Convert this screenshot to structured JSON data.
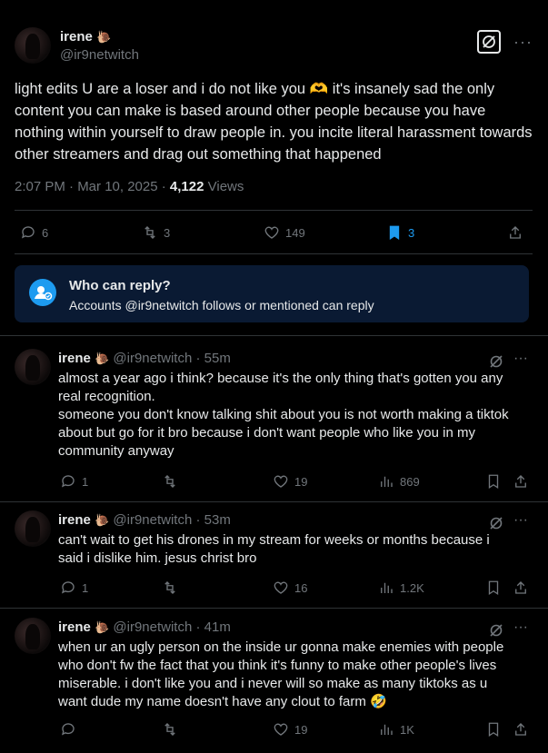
{
  "main": {
    "author_name": "irene",
    "author_badge": "🐌",
    "author_handle": "@ir9netwitch",
    "text": "light edits U are a loser and i do not like you 🫶 it's insanely sad the only content you can make is based around other people because you have nothing within yourself to draw people in. you incite literal harassment towards other streamers and drag out something that happened",
    "timestamp": "2:07 PM · Mar 10, 2025 · ",
    "views_count": "4,122",
    "views_label": " Views",
    "replies": "6",
    "reposts": "3",
    "likes": "149",
    "bookmarks": "3"
  },
  "reply_box": {
    "title": "Who can reply?",
    "subtitle": "Accounts @ir9netwitch follows or mentioned can reply"
  },
  "replies": [
    {
      "name": "irene",
      "badge": "🐌",
      "meta": "@ir9netwitch · 55m",
      "text": "almost a year ago i think? because it's the only thing that's gotten you any real recognition.\nsomeone you don't know talking shit about you is not worth making a tiktok about but go for it bro because i don't want people who like you in my community anyway",
      "replies": "1",
      "reposts": "",
      "likes": "19",
      "views": "869"
    },
    {
      "name": "irene",
      "badge": "🐌",
      "meta": "@ir9netwitch · 53m",
      "text": "can't wait to get his drones in my stream for weeks or months because i said i dislike him. jesus christ bro",
      "replies": "1",
      "reposts": "",
      "likes": "16",
      "views": "1.2K"
    },
    {
      "name": "irene",
      "badge": "🐌",
      "meta": "@ir9netwitch · 41m",
      "text": "when ur an ugly person on the inside ur gonna make enemies with people who don't fw the fact that you think it's funny to make other people's lives miserable. i don't like you and i never will so make as many tiktoks as u want dude my name doesn't have any clout to farm 🤣",
      "replies": "",
      "reposts": "",
      "likes": "19",
      "views": "1K"
    }
  ],
  "icons": {
    "grok": "grok-icon",
    "more": "more-icon",
    "reply": "reply-icon",
    "repost": "repost-icon",
    "like": "like-icon",
    "views": "views-icon",
    "bookmark": "bookmark-icon",
    "share": "share-icon",
    "person": "person-icon"
  },
  "colors": {
    "accent": "#1d9bf0",
    "muted": "#71767b",
    "reply_box_bg": "#0a1a33"
  }
}
